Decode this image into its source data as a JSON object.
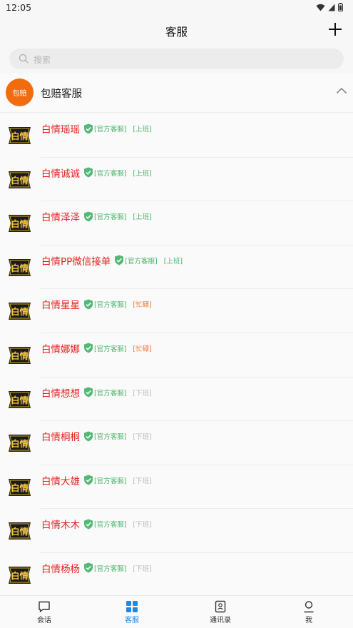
{
  "status_bar": {
    "time": "12:05"
  },
  "header": {
    "title": "客服"
  },
  "search": {
    "placeholder": "搜索"
  },
  "group": {
    "avatar_text": "包赔",
    "title": "包赔客服"
  },
  "list": [
    {
      "name": "白情瑶瑶",
      "tag": "[官方客服]",
      "status": "[上班]",
      "state": "on"
    },
    {
      "name": "白情诚诚",
      "tag": "[官方客服]",
      "status": "[上班]",
      "state": "on"
    },
    {
      "name": "白情泽泽",
      "tag": "[官方客服]",
      "status": "[上班]",
      "state": "on"
    },
    {
      "name": "白情PP微信接单",
      "tag": "[官方客服]",
      "status": "[上班]",
      "state": "on"
    },
    {
      "name": "白情星星",
      "tag": "[官方客服]",
      "status": "[忙碌]",
      "state": "busy"
    },
    {
      "name": "白情娜娜",
      "tag": "[官方客服]",
      "status": "[忙碌]",
      "state": "busy"
    },
    {
      "name": "白情想想",
      "tag": "[官方客服]",
      "status": "[下班]",
      "state": "off"
    },
    {
      "name": "白情桐桐",
      "tag": "[官方客服]",
      "status": "[下班]",
      "state": "off"
    },
    {
      "name": "白情大雄",
      "tag": "[官方客服]",
      "status": "[下班]",
      "state": "off"
    },
    {
      "name": "白情木木",
      "tag": "[官方客服]",
      "status": "[下班]",
      "state": "off"
    },
    {
      "name": "白情杨杨",
      "tag": "[官方客服]",
      "status": "[下班]",
      "state": "off"
    }
  ],
  "avatar_logo_text": "白情",
  "bottom_nav": [
    {
      "label": "会话",
      "icon": "chat-icon",
      "active": false
    },
    {
      "label": "客服",
      "icon": "grid-icon",
      "active": true
    },
    {
      "label": "通讯录",
      "icon": "contacts-icon",
      "active": false
    },
    {
      "label": "我",
      "icon": "user-icon",
      "active": false
    }
  ],
  "colors": {
    "accent": "#1e88e5",
    "name": "#e52222",
    "on": "#49b26a",
    "busy": "#f0712a",
    "off": "#b9b9b9",
    "group_avatar": "#f26b0f"
  }
}
